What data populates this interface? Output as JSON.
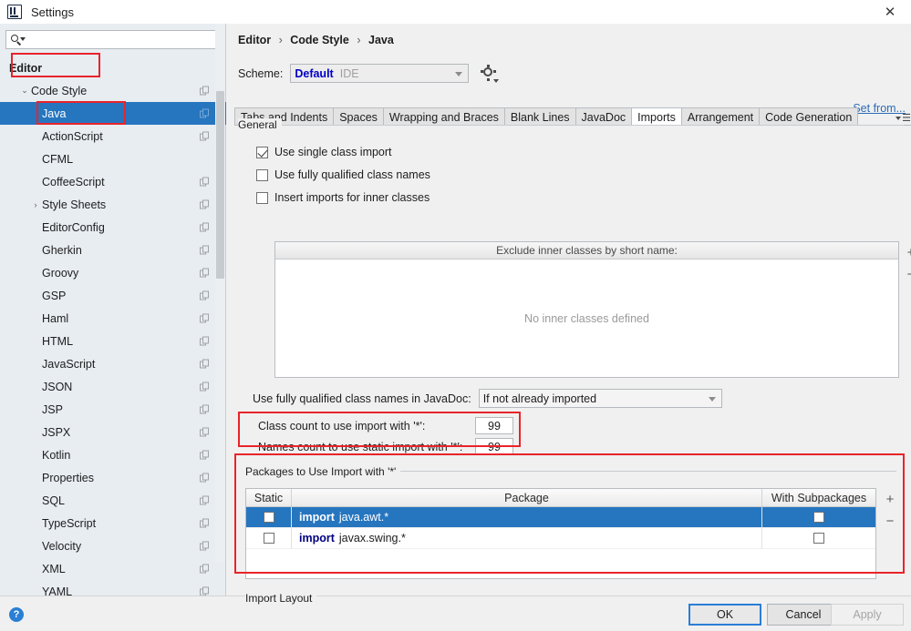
{
  "window": {
    "title": "Settings",
    "app_icon": "intellij-idea-icon",
    "close_icon": "✕"
  },
  "sidebar": {
    "search": {
      "value": "",
      "placeholder": ""
    },
    "items": [
      {
        "label": "Editor",
        "bold": true,
        "indent": 10,
        "arrow": "",
        "copy": false,
        "selected": false
      },
      {
        "label": "Code Style",
        "bold": false,
        "indent": 20,
        "arrow": "⌄",
        "copy": true,
        "selected": false
      },
      {
        "label": "Java",
        "bold": false,
        "indent": 46,
        "arrow": "",
        "copy": true,
        "selected": true
      },
      {
        "label": "ActionScript",
        "bold": false,
        "indent": 46,
        "arrow": "",
        "copy": true,
        "selected": false
      },
      {
        "label": "CFML",
        "bold": false,
        "indent": 46,
        "arrow": "",
        "copy": false,
        "selected": false
      },
      {
        "label": "CoffeeScript",
        "bold": false,
        "indent": 46,
        "arrow": "",
        "copy": true,
        "selected": false
      },
      {
        "label": "Style Sheets",
        "bold": false,
        "indent": 32,
        "arrow": "›",
        "copy": true,
        "selected": false
      },
      {
        "label": "EditorConfig",
        "bold": false,
        "indent": 46,
        "arrow": "",
        "copy": true,
        "selected": false
      },
      {
        "label": "Gherkin",
        "bold": false,
        "indent": 46,
        "arrow": "",
        "copy": true,
        "selected": false
      },
      {
        "label": "Groovy",
        "bold": false,
        "indent": 46,
        "arrow": "",
        "copy": true,
        "selected": false
      },
      {
        "label": "GSP",
        "bold": false,
        "indent": 46,
        "arrow": "",
        "copy": true,
        "selected": false
      },
      {
        "label": "Haml",
        "bold": false,
        "indent": 46,
        "arrow": "",
        "copy": true,
        "selected": false
      },
      {
        "label": "HTML",
        "bold": false,
        "indent": 46,
        "arrow": "",
        "copy": true,
        "selected": false
      },
      {
        "label": "JavaScript",
        "bold": false,
        "indent": 46,
        "arrow": "",
        "copy": true,
        "selected": false
      },
      {
        "label": "JSON",
        "bold": false,
        "indent": 46,
        "arrow": "",
        "copy": true,
        "selected": false
      },
      {
        "label": "JSP",
        "bold": false,
        "indent": 46,
        "arrow": "",
        "copy": true,
        "selected": false
      },
      {
        "label": "JSPX",
        "bold": false,
        "indent": 46,
        "arrow": "",
        "copy": true,
        "selected": false
      },
      {
        "label": "Kotlin",
        "bold": false,
        "indent": 46,
        "arrow": "",
        "copy": true,
        "selected": false
      },
      {
        "label": "Properties",
        "bold": false,
        "indent": 46,
        "arrow": "",
        "copy": true,
        "selected": false
      },
      {
        "label": "SQL",
        "bold": false,
        "indent": 46,
        "arrow": "",
        "copy": true,
        "selected": false
      },
      {
        "label": "TypeScript",
        "bold": false,
        "indent": 46,
        "arrow": "",
        "copy": true,
        "selected": false
      },
      {
        "label": "Velocity",
        "bold": false,
        "indent": 46,
        "arrow": "",
        "copy": true,
        "selected": false
      },
      {
        "label": "XML",
        "bold": false,
        "indent": 46,
        "arrow": "",
        "copy": true,
        "selected": false
      },
      {
        "label": "YAML",
        "bold": false,
        "indent": 46,
        "arrow": "",
        "copy": true,
        "selected": false
      }
    ]
  },
  "breadcrumb": {
    "part1": "Editor",
    "sep1": "›",
    "part2": "Code Style",
    "sep2": "›",
    "part3": "Java"
  },
  "scheme": {
    "label": "Scheme:",
    "name": "Default",
    "scope": "IDE",
    "gear_icon": "gear-icon"
  },
  "set_from_link": "Set from...",
  "tabs": [
    {
      "label": "Tabs and Indents",
      "active": false
    },
    {
      "label": "Spaces",
      "active": false
    },
    {
      "label": "Wrapping and Braces",
      "active": false
    },
    {
      "label": "Blank Lines",
      "active": false
    },
    {
      "label": "JavaDoc",
      "active": false
    },
    {
      "label": "Imports",
      "active": true
    },
    {
      "label": "Arrangement",
      "active": false
    },
    {
      "label": "Code Generation",
      "active": false
    }
  ],
  "general": {
    "title": "General",
    "checkboxes": [
      {
        "label": "Use single class import",
        "checked": true
      },
      {
        "label": "Use fully qualified class names",
        "checked": false
      },
      {
        "label": "Insert imports for inner classes",
        "checked": false
      }
    ]
  },
  "exclude_panel": {
    "header": "Exclude inner classes by short name:",
    "empty_text": "No inner classes defined",
    "add_label": "+",
    "remove_label": "−"
  },
  "javadoc": {
    "label": "Use fully qualified class names in JavaDoc:",
    "value": "If not already imported"
  },
  "counts": {
    "class_count_label": "Class count to use import with '*':",
    "class_count_value": "99",
    "names_count_label": "Names count to use static import with '*':",
    "names_count_value": "99"
  },
  "packages": {
    "title": "Packages to Use Import with '*'",
    "columns": [
      "Static",
      "Package",
      "With Subpackages"
    ],
    "rows": [
      {
        "static_checked": false,
        "keyword": "import",
        "package": "java.awt.*",
        "sub_checked": false,
        "selected": true
      },
      {
        "static_checked": false,
        "keyword": "import",
        "package": "javax.swing.*",
        "sub_checked": false,
        "selected": false
      }
    ],
    "add_label": "+",
    "remove_label": "−"
  },
  "import_layout_title": "Import Layout",
  "footer": {
    "help_label": "?",
    "ok_label": "OK",
    "cancel_label": "Cancel",
    "apply_label": "Apply"
  },
  "colors": {
    "selection_blue": "#2675bf",
    "annotation_red": "#e8242a",
    "link_blue": "#2b6cb8",
    "scheme_name_blue": "#0000c8",
    "keyword_navy": "#000080",
    "sidebar_bg": "#e8edf2",
    "panel_bg": "#f0f0f0"
  }
}
